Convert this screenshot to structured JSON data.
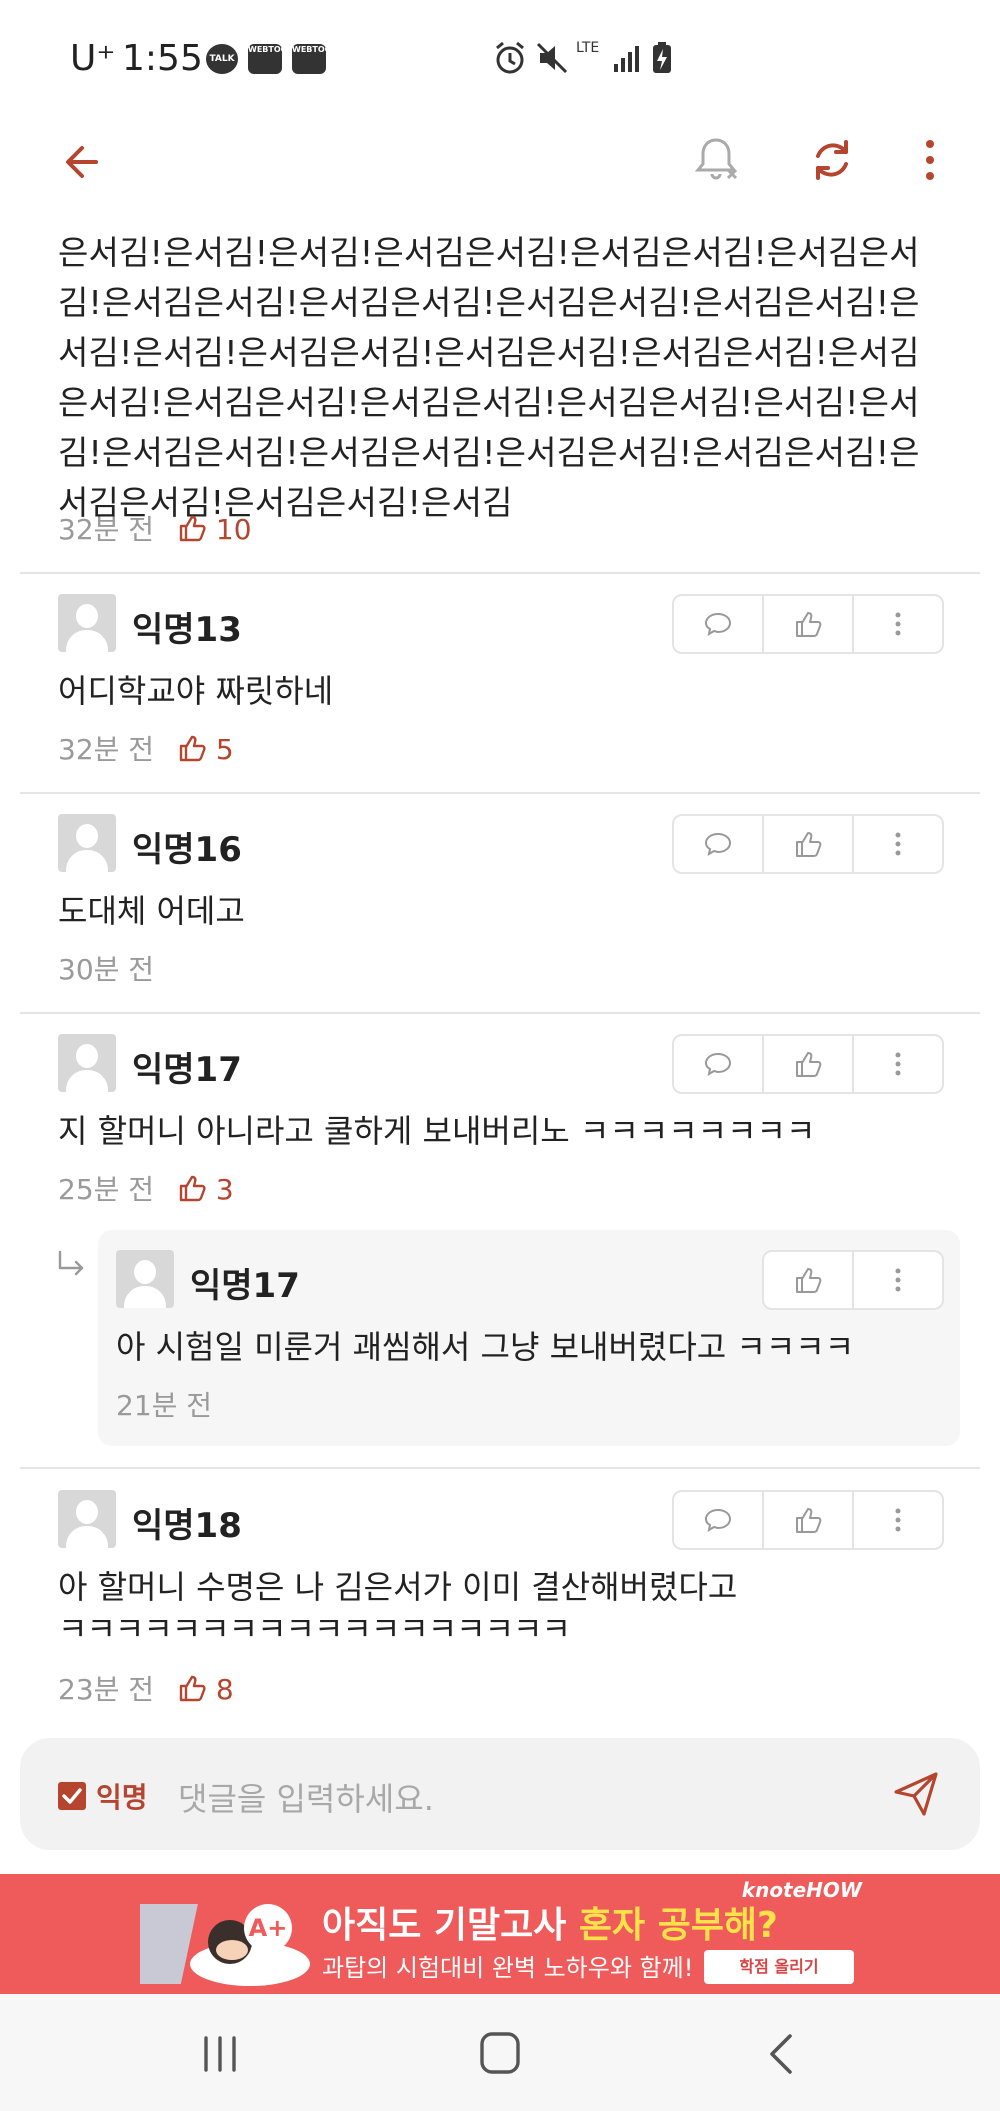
{
  "status_bar": {
    "carrier": "U⁺",
    "time": "1:55",
    "notifications": [
      "TALK",
      "WEBTOON",
      "WEBTOON"
    ],
    "network": "LTE"
  },
  "toolbar": {
    "back_icon": "arrow-left-icon",
    "notify_icon": "bell-off-icon",
    "refresh_icon": "refresh-icon",
    "more_icon": "more-vertical-icon",
    "accent": "#b5452f"
  },
  "post": {
    "body": "은서김!은서김!은서김!은서김은서김!은서김은서김!은서김은서김!은서김은서김!은서김은서김!은서김은서김!은서김은서김!은서김!은서김!은서김은서김!은서김은서김!은서김은서김!은서김은서김!은서김은서김!은서김은서김!은서김은서김!은서김!은서김!은서김은서김!은서김은서김!은서김은서김!은서김은서김!은서김은서김!은서김은서김!은서김",
    "time": "32분 전",
    "likes": "10"
  },
  "comments": [
    {
      "author": "익명13",
      "text": "어디학교야 짜릿하네",
      "time": "32분 전",
      "likes": "5"
    },
    {
      "author": "익명16",
      "text": "도대체 어데고",
      "time": "30분 전",
      "likes": ""
    },
    {
      "author": "익명17",
      "text": "지 할머니 아니라고 쿨하게 보내버리노 ㅋㅋㅋㅋㅋㅋㅋㅋ",
      "time": "25분 전",
      "likes": "3",
      "reply": {
        "author": "익명17",
        "text": "아 시험일 미룬거 괘씸해서 그냥 보내버렸다고 ㅋㅋㅋㅋ",
        "time": "21분 전"
      }
    },
    {
      "author": "익명18",
      "text_line1": "아 할머니 수명은 나 김은서가 이미 결산해버렸다고",
      "text_line2": "ㅋㅋㅋㅋㅋㅋㅋㅋㅋㅋㅋㅋㅋㅋㅋㅋㅋㅋ",
      "time": "23분 전",
      "likes": "8"
    }
  ],
  "input": {
    "anonymous_label": "익명",
    "anonymous_checked": true,
    "placeholder": "댓글을 입력하세요.",
    "send_icon": "send-icon"
  },
  "ad": {
    "brand": "knoteHOW",
    "badge": "A+",
    "headline_prefix": "아직도 기말고사 ",
    "headline_highlight": "혼자 공부해?",
    "subline": "과탑의 시험대비 완벽 노하우와 함께!",
    "button": "학점 올리기",
    "background": "#ef5a5a"
  },
  "navbar": {
    "recent_icon": "recent-apps-icon",
    "home_icon": "home-icon",
    "back_icon": "back-icon"
  }
}
